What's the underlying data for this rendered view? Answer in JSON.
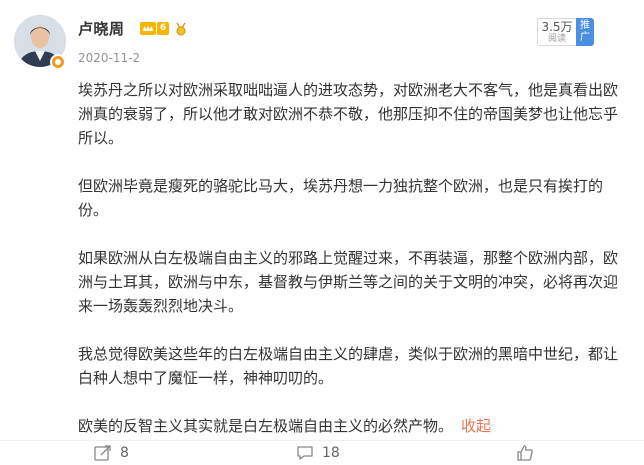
{
  "post": {
    "author": "卢晓周",
    "vip_level": "6",
    "date": "2020-11-2",
    "read_count": "3.5万",
    "read_label": "阅读",
    "push_label": "推广",
    "paragraphs": [
      "埃苏丹之所以对欧洲采取咄咄逼人的进攻态势，对欧洲老大不客气，他是真看出欧洲真的衰弱了，所以他才敢对欧洲不恭不敬，他那压抑不住的帝国美梦也让他忘乎所以。",
      "但欧洲毕竟是瘦死的骆驼比马大，埃苏丹想一力独抗整个欧洲，也是只有挨打的份。",
      "如果欧洲从白左极端自由主义的邪路上觉醒过来，不再装逼，那整个欧洲内部，欧洲与土耳其，欧洲与中东，基督教与伊斯兰等之间的关于文明的冲突，必将再次迎来一场轰轰烈烈地决斗。",
      "我总觉得欧美这些年的白左极端自由主义的肆虐，类似于欧洲的黑暗中世纪，都让白种人想中了魔怔一样，神神叨叨的。",
      "欧美的反智主义其实就是白左极端自由主义的必然产物。"
    ],
    "collapse_label": "收起"
  },
  "footer": {
    "reposts": "8",
    "comments": "18"
  },
  "colors": {
    "accent": "#eb7350",
    "push": "#4a90e2",
    "vip": "#f7b500"
  },
  "icons": [
    "share-icon",
    "comment-icon",
    "like-icon",
    "crown-icon",
    "medal-icon"
  ]
}
